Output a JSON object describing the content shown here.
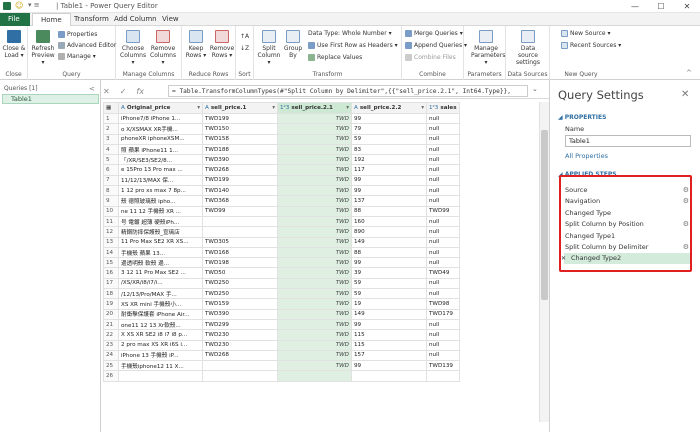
{
  "window": {
    "title": "| Table1 - Power Query Editor",
    "controls": [
      "—",
      "☐",
      "✕"
    ]
  },
  "tabs": [
    "File",
    "Home",
    "Transform",
    "Add Column",
    "View"
  ],
  "ribbon": {
    "close": {
      "close_load": "Close & Load ▾",
      "label": "Close"
    },
    "query": {
      "refresh": "Refresh Preview ▾",
      "properties": "Properties",
      "advanced": "Advanced Editor",
      "manage": "Manage ▾",
      "label": "Query"
    },
    "manage_columns": {
      "choose": "Choose Columns ▾",
      "remove": "Remove Columns ▾",
      "label": "Manage Columns"
    },
    "reduce_rows": {
      "keep": "Keep Rows ▾",
      "remove": "Remove Rows ▾",
      "label": "Reduce Rows"
    },
    "sort": {
      "label": "Sort"
    },
    "transform": {
      "split": "Split Column ▾",
      "group": "Group By",
      "data_type": "Data Type: Whole Number ▾",
      "first_row": "Use First Row as Headers ▾",
      "replace": "Replace Values",
      "label": "Transform"
    },
    "combine": {
      "merge": "Merge Queries ▾",
      "append": "Append Queries ▾",
      "combine_files": "Combine Files",
      "label": "Combine"
    },
    "parameters": {
      "manage": "Manage Parameters ▾",
      "label": "Parameters"
    },
    "data_sources": {
      "settings": "Data source settings",
      "label": "Data Sources"
    },
    "new_query": {
      "new_source": "New Source ▾",
      "recent": "Recent Sources ▾",
      "label": "New Query"
    }
  },
  "queries_pane": {
    "header": "Queries [1]",
    "collapse": "<",
    "items": [
      "Table1"
    ]
  },
  "formula_bar": {
    "cancel": "✕",
    "confirm": "✓",
    "fx": "fx",
    "text": "= Table.TransformColumnTypes(#\"Split Column by Delimiter\",{{\"sell_price.2.1\", Int64.Type}},"
  },
  "grid": {
    "columns": [
      {
        "type": "",
        "name": ""
      },
      {
        "type": "A",
        "name": "Original_price"
      },
      {
        "type": "A",
        "name": "sell_price.1"
      },
      {
        "type": "1²3",
        "name": "sell_price.2.1"
      },
      {
        "type": "A",
        "name": "sell_price.2.2"
      },
      {
        "type": "1²3",
        "name": "sales"
      }
    ],
    "rows": [
      [
        "1",
        "iPhone7/8 iPhone 1...",
        "TWD199",
        "TWD",
        "99",
        "null"
      ],
      [
        "2",
        "o X/XSMAX XR手機...",
        "TWD150",
        "TWD",
        "79",
        "null"
      ],
      [
        "3",
        "phoneXR iphoneXSM...",
        "TWD158",
        "TWD",
        "59",
        "null"
      ],
      [
        "4",
        "照 蘋果 iPhone11 1...",
        "TWD188",
        "TWD",
        "83",
        "null"
      ],
      [
        "5",
        "「/XR/SE3/SE2/8...",
        "TWD390",
        "TWD",
        "192",
        "null"
      ],
      [
        "6",
        "e 15Pro 13 Pro max ...",
        "TWD268",
        "TWD",
        "117",
        "null"
      ],
      [
        "7",
        "11/12/13/MAX 保...",
        "TWD199",
        "TWD",
        "99",
        "null"
      ],
      [
        "8",
        "1 12 pro xs max 7 8p...",
        "TWD140",
        "TWD",
        "99",
        "null"
      ],
      [
        "9",
        "殼 德照玻璃殼 ipho...",
        "TWD368",
        "TWD",
        "137",
        "null"
      ],
      [
        "10",
        "ne 11 12 手機殼 XR ...",
        "TWD99",
        "TWD",
        "88",
        "TWD99"
      ],
      [
        "11",
        "号 電鍍 超薄 硬殼iPh...",
        "",
        "TWD",
        "160",
        "null"
      ],
      [
        "12",
        "精鋼防摔保護殼_宣璃店",
        "",
        "TWD",
        "890",
        "null"
      ],
      [
        "13",
        "11 Pro Max SE2 XR XS...",
        "TWD305",
        "TWD",
        "149",
        "null"
      ],
      [
        "14",
        "手機殼 蘋果 13...",
        "TWD168",
        "TWD",
        "88",
        "null"
      ],
      [
        "15",
        "邊透明殼 軟殼 邊...",
        "TWD198",
        "TWD",
        "99",
        "null"
      ],
      [
        "16",
        "3 12 11 Pro Max SE2 ...",
        "TWD50",
        "TWD",
        "39",
        "TWD49"
      ],
      [
        "17",
        "/XS/XR/i8/i7/i...",
        "TWD250",
        "TWD",
        "59",
        "null"
      ],
      [
        "18",
        "/12/13/Pro/MAX 手...",
        "TWD250",
        "TWD",
        "59",
        "null"
      ],
      [
        "19",
        "XS XR mini 手機殼小...",
        "TWD159",
        "TWD",
        "19",
        "TWD98"
      ],
      [
        "20",
        "耐衝擊保護套 iPhone Air...",
        "TWD390",
        "TWD",
        "149",
        "TWD179"
      ],
      [
        "21",
        "one11 12 13 Xr軟殼...",
        "TWD299",
        "TWD",
        "99",
        "null"
      ],
      [
        "22",
        "X XS XR SE2 i8 i7 i8 p...",
        "TWD230",
        "TWD",
        "115",
        "null"
      ],
      [
        "23",
        "2 pro max XS XR i6S i...",
        "TWD230",
        "TWD",
        "115",
        "null"
      ],
      [
        "24",
        "iPhone 13 手機殼 iP...",
        "TWD268",
        "TWD",
        "157",
        "null"
      ],
      [
        "25",
        "手機殼iphone12 11 X...",
        "",
        "TWD",
        "99",
        "TWD139"
      ],
      [
        "26",
        "",
        "",
        "",
        "",
        ""
      ]
    ]
  },
  "settings": {
    "title": "Query Settings",
    "close": "✕",
    "properties_header": "PROPERTIES",
    "name_label": "Name",
    "name_value": "Table1",
    "all_properties": "All Properties",
    "applied_header": "APPLIED STEPS",
    "steps": [
      {
        "label": "Source",
        "gear": true
      },
      {
        "label": "Navigation",
        "gear": true
      },
      {
        "label": "Changed Type",
        "gear": false
      },
      {
        "label": "Split Column by Position",
        "gear": true
      },
      {
        "label": "Changed Type1",
        "gear": false
      },
      {
        "label": "Split Column by Delimiter",
        "gear": true
      },
      {
        "label": "Changed Type2",
        "gear": false,
        "selected": true
      }
    ]
  },
  "colors": {
    "accent": "#217346",
    "selected_col": "#dff0e3",
    "highlight": "#e02020",
    "link": "#2f6fa3"
  }
}
